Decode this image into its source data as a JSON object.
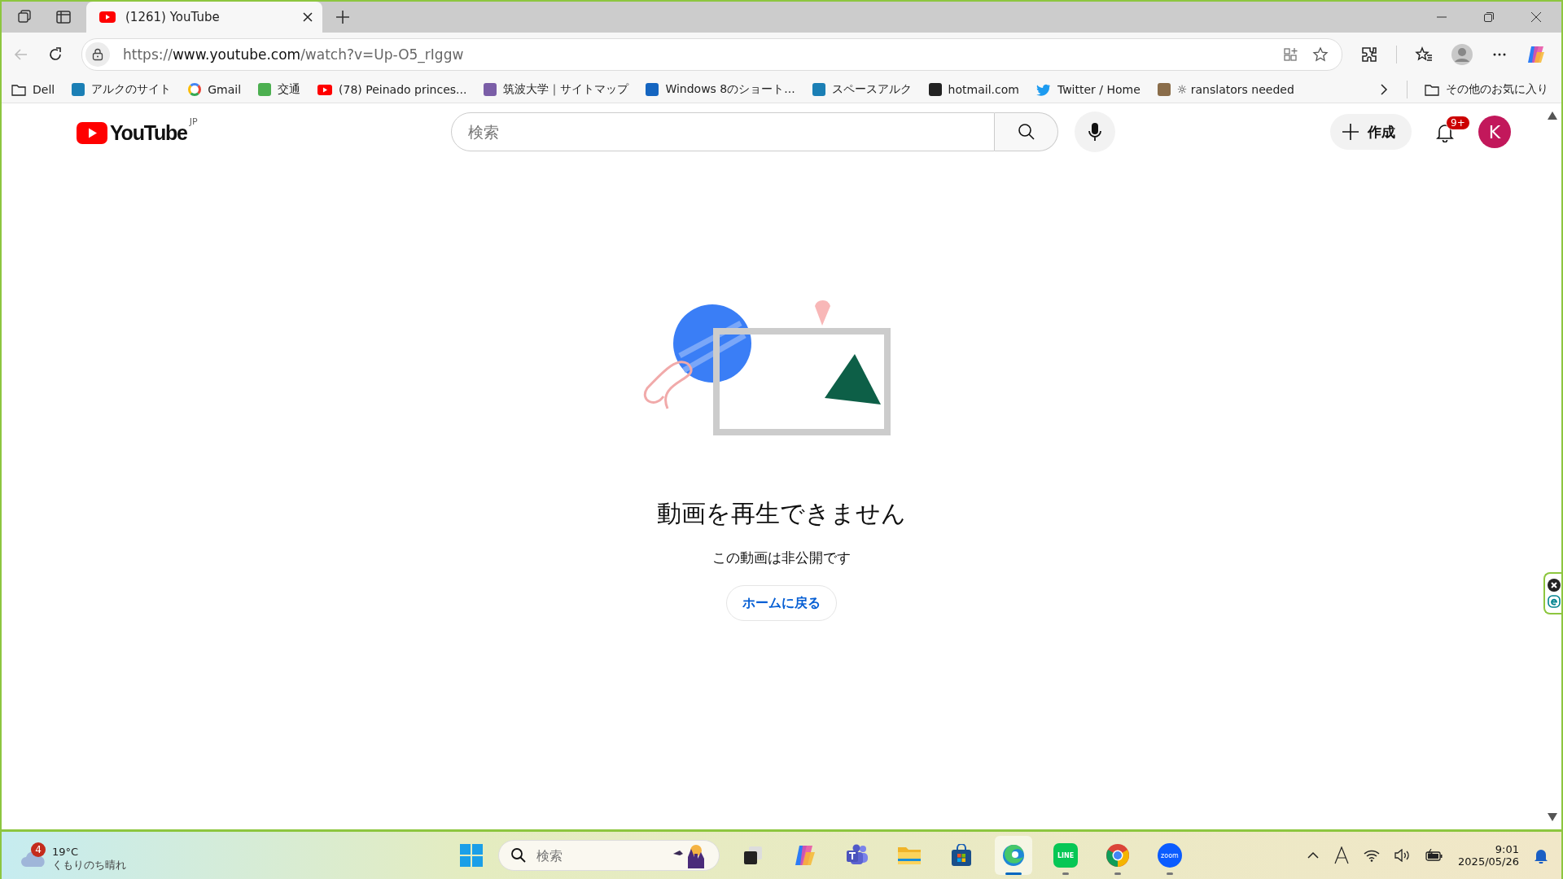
{
  "browser": {
    "tabs": [
      {
        "title": "(1261) YouTube",
        "selected": true
      }
    ],
    "address": {
      "scheme": "https://",
      "host": "www.youtube.com",
      "path": "/watch?v=Up-O5_rIggw"
    },
    "bookmarks": [
      {
        "kind": "folder",
        "label": "Dell"
      },
      {
        "kind": "alc",
        "label": "アルクのサイト"
      },
      {
        "kind": "google",
        "label": "Gmail"
      },
      {
        "kind": "kotsu",
        "label": "交通"
      },
      {
        "kind": "youtube",
        "label": "(78) Peinado princes..."
      },
      {
        "kind": "tsukuba",
        "label": "筑波大学｜サイトマップ"
      },
      {
        "kind": "windows",
        "label": "Windows 8のショート..."
      },
      {
        "kind": "alc",
        "label": "スペースアルク"
      },
      {
        "kind": "hotmail",
        "label": "hotmail.com"
      },
      {
        "kind": "twitter",
        "label": "Twitter / Home"
      },
      {
        "kind": "photo",
        "label": "☼ ranslators needed"
      }
    ],
    "other_favorites": "その他のお気に入り"
  },
  "youtube": {
    "logo": "YouTube",
    "region": "JP",
    "search_placeholder": "検索",
    "create_button": "作成",
    "notification_count": "9+",
    "avatar_letter": "K"
  },
  "error": {
    "title": "動画を再生できません",
    "message": "この動画は非公開です",
    "home_button": "ホームに戻る"
  },
  "taskbar": {
    "weather": {
      "badge": "4",
      "temperature": "19°C",
      "condition": "くもりのち晴れ"
    },
    "search_placeholder": "検索",
    "apps": [
      {
        "kind": "taskview",
        "running": false,
        "selected": false
      },
      {
        "kind": "copilot",
        "running": false,
        "selected": false
      },
      {
        "kind": "teams",
        "running": false,
        "selected": false
      },
      {
        "kind": "explorer",
        "running": false,
        "selected": false
      },
      {
        "kind": "store",
        "running": false,
        "selected": false
      },
      {
        "kind": "edge",
        "running": true,
        "selected": true
      },
      {
        "kind": "line",
        "label": "LINE",
        "running": true,
        "selected": false
      },
      {
        "kind": "chrome",
        "running": true,
        "selected": false
      },
      {
        "kind": "zoom",
        "label": "zoom",
        "running": true,
        "selected": false
      }
    ],
    "time": "9:01",
    "date": "2025/05/26"
  }
}
